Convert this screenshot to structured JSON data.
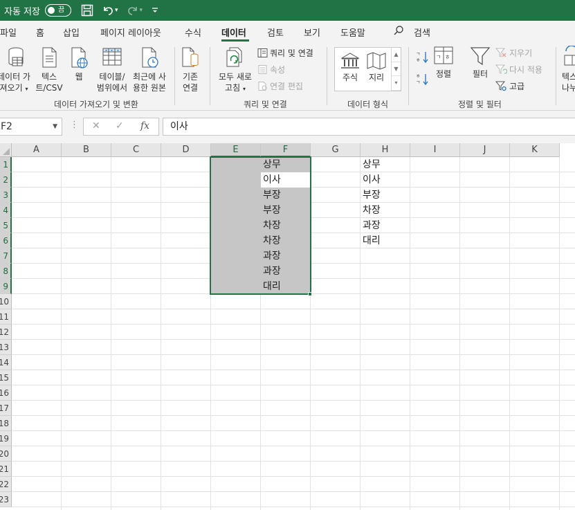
{
  "titlebar": {
    "autosave_label": "자동 저장",
    "toggle_state": "끔",
    "accent_color": "#217346"
  },
  "tabs": [
    {
      "label": "파일"
    },
    {
      "label": "홈"
    },
    {
      "label": "삽입"
    },
    {
      "label": "페이지 레이아웃"
    },
    {
      "label": "수식"
    },
    {
      "label": "데이터",
      "active": true
    },
    {
      "label": "검토"
    },
    {
      "label": "보기"
    },
    {
      "label": "도움말"
    }
  ],
  "search": {
    "label": "검색",
    "icon": "search-icon"
  },
  "ribbon": {
    "get_data": {
      "line1": "데이터 가",
      "line2": "져오기"
    },
    "text_csv": {
      "line1": "텍스",
      "line2": "트/CSV"
    },
    "web": {
      "label": "웹"
    },
    "table_range": {
      "line1": "테이블/",
      "line2": "범위에서"
    },
    "recent_sources": {
      "line1": "최근에 사",
      "line2": "용한 원본"
    },
    "existing_conn": {
      "line1": "기존",
      "line2": "연결"
    },
    "group1_label": "데이터 가져오기 및 변환",
    "refresh_all": {
      "line1": "모두 새로",
      "line2": "고침"
    },
    "queries_connections": "쿼리 및 연결",
    "properties": "속성",
    "edit_links": "연결 편집",
    "group2_label": "쿼리 및 연결",
    "stocks": "주식",
    "geography": "지리",
    "group3_label": "데이터 형식",
    "sort": "정렬",
    "filter": "필터",
    "clear": "지우기",
    "reapply": "다시 적용",
    "advanced": "고급",
    "group4_label": "정렬 및 필터",
    "text_to_columns_partial": {
      "line1": "텍스",
      "line2": "나누"
    }
  },
  "formula_bar": {
    "name_box": "F2",
    "formula": "이사"
  },
  "columns": [
    "A",
    "B",
    "C",
    "D",
    "E",
    "F",
    "G",
    "H",
    "I",
    "J",
    "K"
  ],
  "selected_columns": [
    "E",
    "F"
  ],
  "rows": [
    "1",
    "2",
    "3",
    "4",
    "5",
    "6",
    "7",
    "8",
    "9",
    "10",
    "11",
    "12",
    "13",
    "14",
    "15",
    "16",
    "17",
    "18",
    "19",
    "20",
    "21",
    "22",
    "23"
  ],
  "selected_rows": [
    "1",
    "2",
    "3",
    "4",
    "5",
    "6",
    "7",
    "8",
    "9"
  ],
  "selection_range": "E1:F9",
  "active_cell": "F2",
  "column_f": [
    "상무",
    "이사",
    "부장",
    "부장",
    "차장",
    "차장",
    "과장",
    "과장",
    "대리"
  ],
  "column_h": [
    "상무",
    "이사",
    "부장",
    "차장",
    "과장",
    "대리"
  ]
}
